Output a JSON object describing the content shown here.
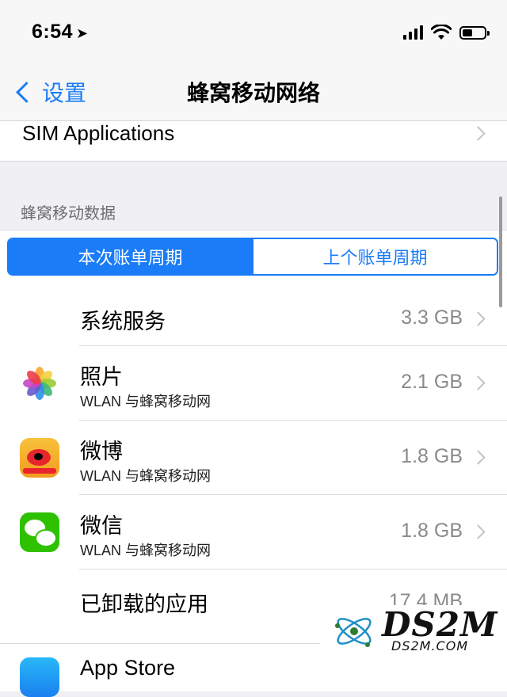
{
  "status_bar": {
    "time": "6:54",
    "location_icon": "location-arrow-icon",
    "battery_fraction": 0.45
  },
  "nav": {
    "back_label": "设置",
    "title": "蜂窝移动网络"
  },
  "sim": {
    "label": "SIM Applications"
  },
  "section_header": "蜂窝移动数据",
  "segment": {
    "options": [
      "本次账单周期",
      "上个账单周期"
    ],
    "selected_index": 0
  },
  "usage_rows": [
    {
      "title": "系统服务",
      "value": "3.3 GB"
    },
    {
      "title": "照片",
      "subtitle": "WLAN 与蜂窝移动网",
      "value": "2.1 GB",
      "icon": "photos-icon"
    },
    {
      "title": "微博",
      "subtitle": "WLAN 与蜂窝移动网",
      "value": "1.8 GB",
      "icon": "weibo-icon"
    },
    {
      "title": "微信",
      "subtitle": "WLAN 与蜂窝移动网",
      "value": "1.8 GB",
      "icon": "wechat-icon"
    },
    {
      "title": "已卸载的应用",
      "value": "17.4 MB"
    },
    {
      "title": "App Store",
      "icon": "app-store-icon"
    }
  ],
  "watermark": {
    "text": "DS2M",
    "subtext": "DS2M.COM"
  },
  "colors": {
    "accent": "#1a7cf7",
    "background": "#efeff4"
  }
}
